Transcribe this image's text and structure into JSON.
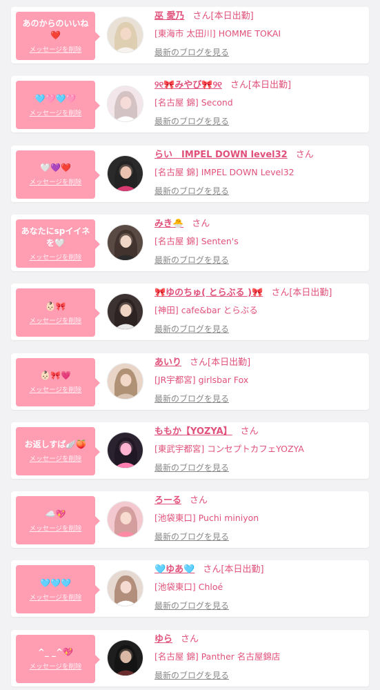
{
  "colors": {
    "accent": "#e0507a",
    "bubble": "#ff9db3",
    "card": "#ffffff",
    "page": "#f2f2f4",
    "muted": "#888888"
  },
  "entries": [
    {
      "message": "あのからのいいね❤️",
      "delete_label": "メッセージを削除",
      "name": "巫 愛乃",
      "san_label": "さん",
      "badge": "[本日出勤]",
      "shop": "[東海市 太田川] HOMME TOKAI",
      "blog_label": "最新のブログを見る",
      "avatar": "photo-avatar"
    },
    {
      "message": "🩵🩷🩵🩷",
      "delete_label": "メッセージを削除",
      "name": "୨୧🎀みやび🎀୨୧",
      "san_label": "さん",
      "badge": "[本日出勤]",
      "shop": "[名古屋 錦] Second",
      "blog_label": "最新のブログを見る",
      "avatar": "photo-avatar"
    },
    {
      "message": "🤍💜❤️",
      "delete_label": "メッセージを削除",
      "name": "らい　IMPEL DOWN level32",
      "san_label": "さん",
      "badge": "",
      "shop": "[名古屋 錦] IMPEL DOWN Level32",
      "blog_label": "最新のブログを見る",
      "avatar": "photo-avatar"
    },
    {
      "message": "あなたにspイイネを🤍",
      "delete_label": "メッセージを削除",
      "name": "みき🐣",
      "san_label": "さん",
      "badge": "",
      "shop": "[名古屋 錦] Senten's",
      "blog_label": "最新のブログを見る",
      "avatar": "photo-avatar"
    },
    {
      "message": "👶🏻🎀",
      "delete_label": "メッセージを削除",
      "name": "🎀ゆのちゅ( とらぶる )🎀",
      "san_label": "さん",
      "badge": "[本日出勤]",
      "shop": "[神田] cafe&bar とらぶる",
      "blog_label": "最新のブログを見る",
      "avatar": "photo-avatar"
    },
    {
      "message": "👶🏻🎀💗",
      "delete_label": "メッセージを削除",
      "name": "あいり",
      "san_label": "さん",
      "badge": "[本日出勤]",
      "shop": "[JR宇都宮] girlsbar Fox",
      "blog_label": "最新のブログを見る",
      "avatar": "photo-avatar"
    },
    {
      "message": "お返しすば🪽🍑",
      "delete_label": "メッセージを削除",
      "name": "ももか【YOZYA】",
      "san_label": "さん",
      "badge": "",
      "shop": "[東武宇都宮] コンセプトカフェYOZYA",
      "blog_label": "最新のブログを見る",
      "avatar": "photo-avatar"
    },
    {
      "message": "☁️💖",
      "delete_label": "メッセージを削除",
      "name": "ろーる",
      "san_label": "さん",
      "badge": "",
      "shop": "[池袋東口] Puchi miniyon",
      "blog_label": "最新のブログを見る",
      "avatar": "photo-avatar"
    },
    {
      "message": "🩵🩵🩵",
      "delete_label": "メッセージを削除",
      "name": "🩵ゆあ🩵",
      "san_label": "さん",
      "badge": "[本日出勤]",
      "shop": "[池袋東口] Chloé",
      "blog_label": "最新のブログを見る",
      "avatar": "photo-avatar"
    },
    {
      "message": "^_ _^💖",
      "delete_label": "メッセージを削除",
      "name": "ゆら",
      "san_label": "さん",
      "badge": "",
      "shop": "[名古屋 錦] Panther 名古屋錦店",
      "blog_label": "最新のブログを見る",
      "avatar": "photo-avatar"
    }
  ]
}
